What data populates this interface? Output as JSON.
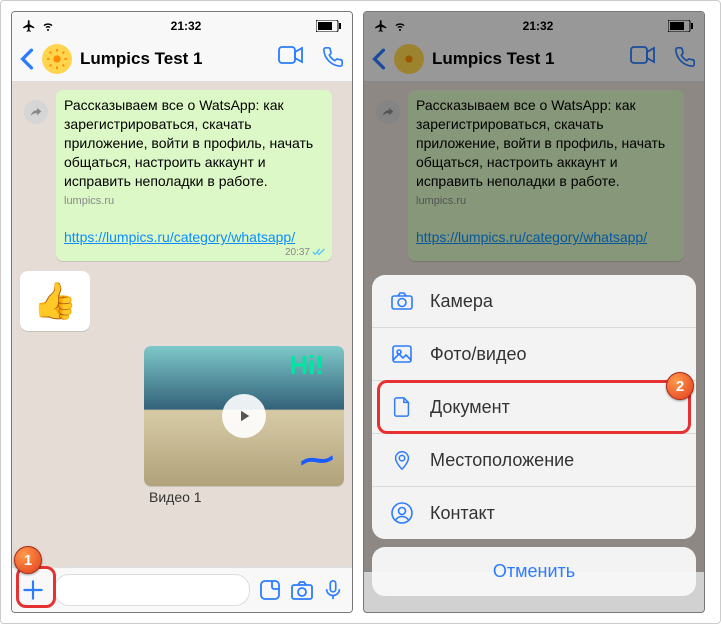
{
  "status": {
    "time": "21:32"
  },
  "chat": {
    "title": "Lumpics Test 1",
    "msg1_text": "Рассказываем все о WatsApp: как зарегистрироваться, скачать приложение, войти в профиль, начать общаться, настроить аккаунт и исправить неполадки в работе.",
    "msg1_domain": "lumpics.ru",
    "msg1_link": "https://lumpics.ru/category/whatsapp/",
    "msg1_time": "20:37",
    "sticker_emoji": "👍",
    "video_caption": "Видео 1",
    "hi_overlay": "Hi!"
  },
  "sheet": {
    "items": {
      "camera": "Камера",
      "photo": "Фото/видео",
      "document": "Документ",
      "location": "Местоположение",
      "contact": "Контакт"
    },
    "cancel": "Отменить"
  },
  "annotations": {
    "b1": "1",
    "b2": "2"
  }
}
